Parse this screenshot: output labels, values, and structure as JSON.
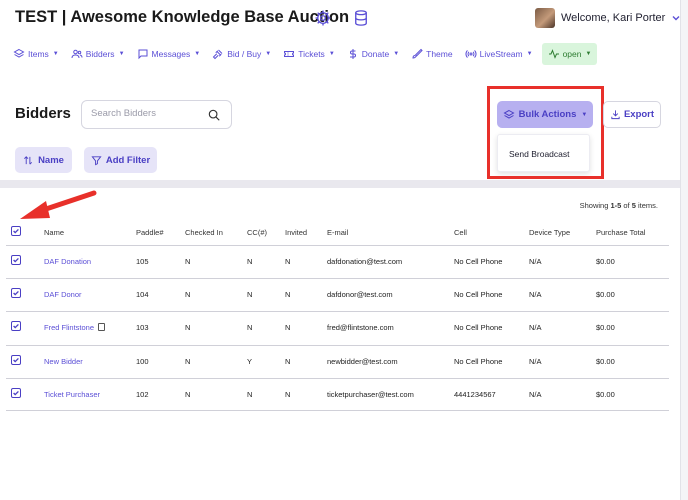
{
  "header": {
    "title": "TEST | Awesome Knowledge Base Auction",
    "icons": [
      "gear-icon",
      "database-icon"
    ],
    "welcome": "Welcome, Kari Porter"
  },
  "nav": [
    {
      "label": "Items",
      "icon": "layers-icon",
      "caret": true
    },
    {
      "label": "Bidders",
      "icon": "users-icon",
      "caret": true
    },
    {
      "label": "Messages",
      "icon": "message-icon",
      "caret": true
    },
    {
      "label": "Bid / Buy",
      "icon": "gavel-icon",
      "caret": true
    },
    {
      "label": "Tickets",
      "icon": "ticket-icon",
      "caret": true
    },
    {
      "label": "Donate",
      "icon": "dollar-icon",
      "caret": true
    },
    {
      "label": "Theme",
      "icon": "brush-icon",
      "caret": false
    },
    {
      "label": "LiveStream",
      "icon": "broadcast-icon",
      "caret": true
    },
    {
      "label": "open",
      "icon": "activity-icon",
      "caret": true
    }
  ],
  "page": {
    "title": "Bidders",
    "search_placeholder": "Search Bidders",
    "bulk_actions": "Bulk Actions",
    "bulk_menu": [
      "Send Broadcast"
    ],
    "export": "Export",
    "sort_name": "Name",
    "add_filter": "Add Filter"
  },
  "pager": {
    "prefix": "Showing ",
    "range": "1-5",
    "mid": " of ",
    "total": "5",
    "suffix": " items."
  },
  "table": {
    "columns": [
      "Name",
      "Paddle#",
      "Checked In",
      "CC(#)",
      "Invited",
      "E-mail",
      "Cell",
      "Device Type",
      "Purchase Total"
    ],
    "rows": [
      {
        "name": "DAF Donation",
        "paddle": "105",
        "checked_in": "N",
        "cc": "N",
        "invited": "N",
        "email": "dafdonation@test.com",
        "cell": "No Cell Phone",
        "device": "N/A",
        "total": "$0.00",
        "note": false
      },
      {
        "name": "DAF Donor",
        "paddle": "104",
        "checked_in": "N",
        "cc": "N",
        "invited": "N",
        "email": "dafdonor@test.com",
        "cell": "No Cell Phone",
        "device": "N/A",
        "total": "$0.00",
        "note": false
      },
      {
        "name": "Fred Flintstone",
        "paddle": "103",
        "checked_in": "N",
        "cc": "N",
        "invited": "N",
        "email": "fred@flintstone.com",
        "cell": "No Cell Phone",
        "device": "N/A",
        "total": "$0.00",
        "note": true
      },
      {
        "name": "New Bidder",
        "paddle": "100",
        "checked_in": "N",
        "cc": "Y",
        "invited": "N",
        "email": "newbidder@test.com",
        "cell": "No Cell Phone",
        "device": "N/A",
        "total": "$0.00",
        "note": false
      },
      {
        "name": "Ticket Purchaser",
        "paddle": "102",
        "checked_in": "N",
        "cc": "N",
        "invited": "N",
        "email": "ticketpurchaser@test.com",
        "cell": "4441234567",
        "device": "N/A",
        "total": "$0.00",
        "note": false
      }
    ]
  },
  "colors": {
    "accent": "#5b4fd6",
    "bulk_bg": "#b7b0f0",
    "highlight": "#e8302a",
    "open_bg": "#d9f5dc"
  }
}
